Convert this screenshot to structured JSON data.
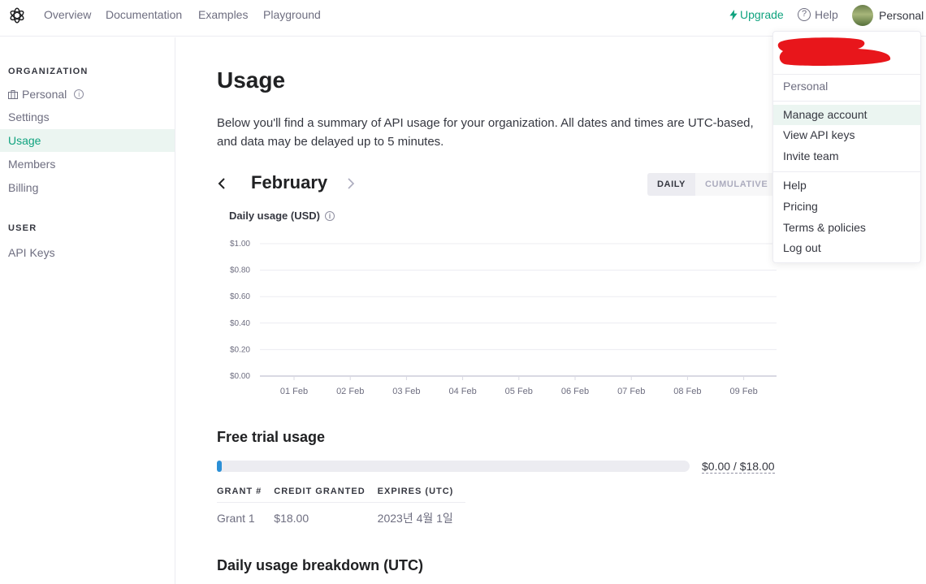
{
  "nav": {
    "links": [
      "Overview",
      "Documentation",
      "Examples",
      "Playground"
    ],
    "upgrade": "Upgrade",
    "help": "Help",
    "profile": "Personal"
  },
  "sidebar": {
    "org_heading": "ORGANIZATION",
    "org_name": "Personal",
    "items": [
      "Settings",
      "Usage",
      "Members",
      "Billing"
    ],
    "active": "Usage",
    "user_heading": "USER",
    "user_items": [
      "API Keys"
    ]
  },
  "main": {
    "title": "Usage",
    "description": "Below you'll find a summary of API usage for your organization. All dates and times are UTC-based, and data may be delayed up to 5 minutes.",
    "month": "February",
    "toggle": {
      "daily": "DAILY",
      "cumulative": "CUMULATIVE",
      "selected": "DAILY"
    }
  },
  "chart_data": {
    "type": "bar",
    "title": "Daily usage (USD)",
    "categories": [
      "01 Feb",
      "02 Feb",
      "03 Feb",
      "04 Feb",
      "05 Feb",
      "06 Feb",
      "07 Feb",
      "08 Feb",
      "09 Feb"
    ],
    "values": [
      0,
      0,
      0,
      0,
      0,
      0,
      0,
      0,
      0
    ],
    "yticks": [
      "$1.00",
      "$0.80",
      "$0.60",
      "$0.40",
      "$0.20",
      "$0.00"
    ],
    "ylim": [
      0,
      1
    ],
    "grid": true
  },
  "trial": {
    "heading": "Free trial usage",
    "used": 0,
    "total": 18,
    "label": "$0.00 / $18.00",
    "columns": [
      "GRANT #",
      "CREDIT GRANTED",
      "EXPIRES (UTC)"
    ],
    "rows": [
      [
        "Grant 1",
        "$18.00",
        "2023년 4월 1일"
      ]
    ]
  },
  "breakdown": {
    "heading": "Daily usage breakdown (UTC)"
  },
  "dropdown": {
    "org": "Personal",
    "group1": [
      "Manage account",
      "View API keys",
      "Invite team"
    ],
    "highlighted": "Manage account",
    "group2": [
      "Help",
      "Pricing",
      "Terms & policies",
      "Log out"
    ]
  },
  "colors": {
    "accent": "#10a37f",
    "redaction": "#e8161b",
    "progress": "#2b8fd6"
  }
}
